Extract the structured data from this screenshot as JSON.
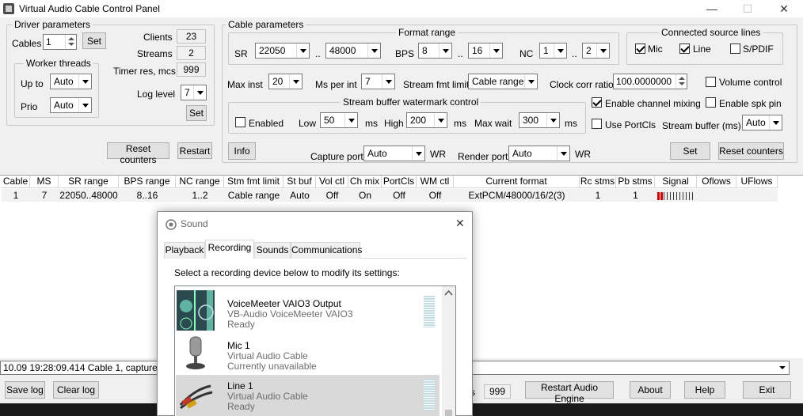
{
  "window": {
    "title": "Virtual Audio Cable Control Panel",
    "minimize": "—",
    "maximize": "☐",
    "close": "✕"
  },
  "driver": {
    "group_title": "Driver parameters",
    "cables_label": "Cables",
    "cables_value": "1",
    "set_label": "Set",
    "clients_label": "Clients",
    "clients_value": "23",
    "streams_label": "Streams",
    "streams_value": "2",
    "timer_label": "Timer res, mcs",
    "timer_value": "999",
    "log_level_label": "Log level",
    "log_level_value": "7",
    "set2_label": "Set",
    "worker": {
      "group_title": "Worker threads",
      "upto_label": "Up to",
      "upto_value": "Auto",
      "prio_label": "Prio",
      "prio_value": "Auto"
    },
    "reset_counters": "Reset counters",
    "restart": "Restart"
  },
  "cable": {
    "group_title": "Cable parameters",
    "format_range": {
      "title": "Format range",
      "sr_label": "SR",
      "sr_min": "22050",
      "sr_max": "48000",
      "dots": "..",
      "bps_label": "BPS",
      "bps_min": "8",
      "bps_max": "16",
      "nc_label": "NC",
      "nc_min": "1",
      "nc_max": "2"
    },
    "connected": {
      "title": "Connected source lines",
      "mic": "Mic",
      "mic_checked": true,
      "line": "Line",
      "line_checked": true,
      "spdif": "S/PDIF",
      "spdif_checked": false
    },
    "max_inst_label": "Max inst",
    "max_inst_value": "20",
    "ms_per_int_label": "Ms per int",
    "ms_per_int_value": "7",
    "stream_fmt_limit_label": "Stream fmt limit",
    "stream_fmt_limit_value": "Cable range",
    "clock_corr_label": "Clock corr ratio",
    "clock_corr_value": "100.0000000",
    "volume_control": "Volume control",
    "volume_control_checked": false,
    "watermark": {
      "title": "Stream buffer watermark control",
      "enabled": "Enabled",
      "enabled_checked": false,
      "low_label": "Low",
      "low_value": "50",
      "ms1": "ms",
      "high_label": "High",
      "high_value": "200",
      "ms2": "ms",
      "maxwait_label": "Max wait",
      "maxwait_value": "300",
      "ms3": "ms"
    },
    "enable_mixing": "Enable channel mixing",
    "enable_mixing_checked": true,
    "enable_spk_pin": "Enable spk pin",
    "enable_spk_pin_checked": false,
    "use_portcls": "Use PortCls",
    "use_portcls_checked": false,
    "stream_buffer_label": "Stream buffer (ms)",
    "stream_buffer_value": "Auto",
    "info": "Info",
    "capture_port_label": "Capture port",
    "capture_port_value": "Auto",
    "wr1": "WR",
    "render_port_label": "Render port",
    "render_port_value": "Auto",
    "wr2": "WR",
    "set_label": "Set",
    "reset_counters": "Reset counters"
  },
  "table": {
    "headers": [
      "Cable",
      "MS",
      "SR range",
      "BPS range",
      "NC range",
      "Stm fmt limit",
      "St buf",
      "Vol ctl",
      "Ch mix",
      "PortCls",
      "WM ctl",
      "Current format",
      "Rc stms",
      "Pb stms",
      "Signal",
      "Oflows",
      "UFlows"
    ],
    "row": [
      "1",
      "7",
      "22050..48000",
      "8..16",
      "1..2",
      "Cable range",
      "Auto",
      "Off",
      "On",
      "Off",
      "Off",
      "ExtPCM/48000/16/2(3)",
      "1",
      "1",
      "",
      "",
      ""
    ],
    "signal_level": 0.15,
    "signal_color": "#cc0000"
  },
  "status_log": "10.09 19:28:09.414 Cable 1, capture str",
  "bottom": {
    "save_log": "Save log",
    "clear_log": "Clear log",
    "partial_label": "s",
    "partial_value": "999",
    "restart_engine": "Restart Audio Engine",
    "about": "About",
    "help": "Help",
    "exit": "Exit"
  },
  "sound": {
    "title": "Sound",
    "close": "✕",
    "tabs": [
      "Playback",
      "Recording",
      "Sounds",
      "Communications"
    ],
    "selected_tab": "Recording",
    "instruction": "Select a recording device below to modify its settings:",
    "devices": [
      {
        "name": "VoiceMeeter VAIO3 Output",
        "driver": "VB-Audio VoiceMeeter VAIO3",
        "status": "Ready",
        "icon": "voicemeeter-icon"
      },
      {
        "name": "Mic 1",
        "driver": "Virtual Audio Cable",
        "status": "Currently unavailable",
        "icon": "microphone-icon"
      },
      {
        "name": "Line 1",
        "driver": "Virtual Audio Cable",
        "status": "Ready",
        "icon": "rca-cable-icon"
      }
    ]
  }
}
